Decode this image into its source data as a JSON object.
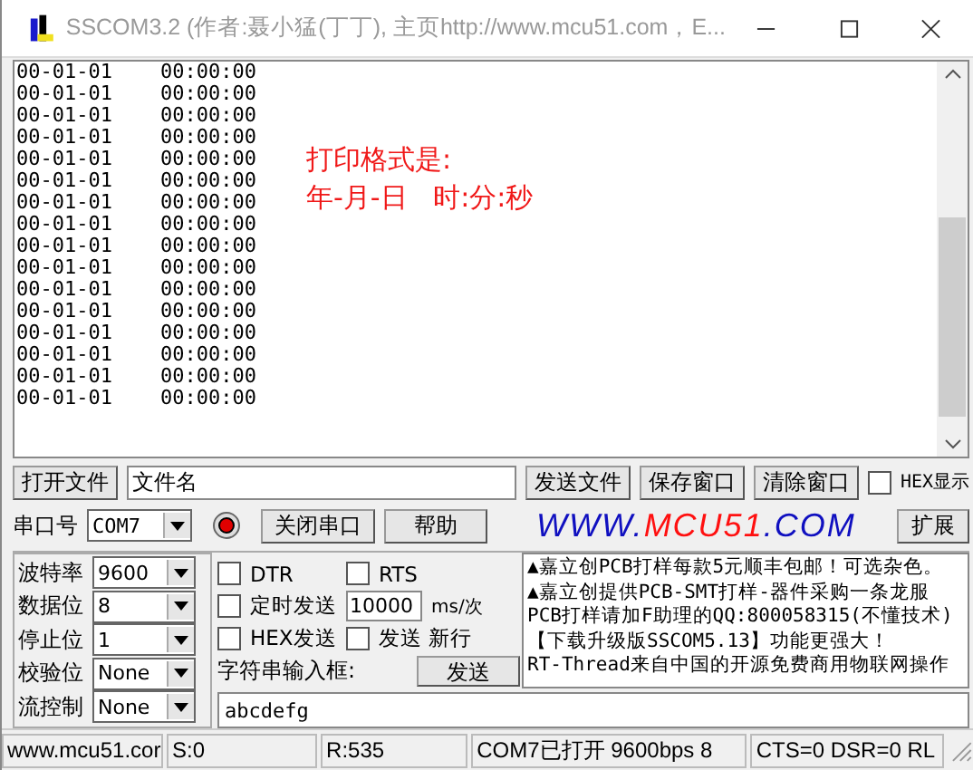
{
  "window": {
    "title": "SSCOM3.2 (作者:聂小猛(丁丁), 主页http://www.mcu51.com，E..."
  },
  "output": {
    "lines": [
      "00-01-01    00:00:00",
      "00-01-01    00:00:00",
      "00-01-01    00:00:00",
      "00-01-01    00:00:00",
      "00-01-01    00:00:00",
      "00-01-01    00:00:00",
      "00-01-01    00:00:00",
      "00-01-01    00:00:00",
      "00-01-01    00:00:00",
      "00-01-01    00:00:00",
      "00-01-01    00:00:00",
      "00-01-01    00:00:00",
      "00-01-01    00:00:00",
      "00-01-01    00:00:00",
      "00-01-01    00:00:00",
      "00-01-01    00:00:00"
    ],
    "note": [
      "打印格式是:",
      "年-月-日   时:分:秒"
    ]
  },
  "file_row": {
    "open_button": "打开文件",
    "file_field": "文件名",
    "send_file_button": "发送文件",
    "save_button": "保存窗口",
    "clear_button": "清除窗口",
    "hex_display": {
      "label": "HEX显示",
      "checked": false
    }
  },
  "port_row": {
    "label": "串口号",
    "port": "COM7",
    "port_open": true,
    "close_button": "关闭串口",
    "help_button": "帮助",
    "logo": [
      {
        "text": "WWW.",
        "color": "#1010c0"
      },
      {
        "text": "MCU51",
        "color": "#ff1010"
      },
      {
        "text": ".COM",
        "color": "#1010c0"
      }
    ],
    "expand_button": "扩展"
  },
  "settings": [
    {
      "label": "波特率",
      "value": "9600"
    },
    {
      "label": "数据位",
      "value": "8"
    },
    {
      "label": "停止位",
      "value": "1"
    },
    {
      "label": "校验位",
      "value": "None"
    },
    {
      "label": "流控制",
      "value": "None"
    }
  ],
  "options": {
    "dtr": {
      "label": "DTR",
      "checked": false
    },
    "rts": {
      "label": "RTS",
      "checked": false
    },
    "timed_send": {
      "label": "定时发送",
      "checked": false
    },
    "interval": "10000",
    "interval_unit": "ms/次",
    "hex_send": {
      "label": "HEX发送",
      "checked": false
    },
    "send_newline": {
      "label": "发送 新行",
      "checked": false
    },
    "input_label": "字符串输入框:",
    "send_button": "发送",
    "input_value": "abcdefg"
  },
  "notices": [
    "▲嘉立创PCB打样每款5元顺丰包邮！可选杂色。",
    "▲嘉立创提供PCB-SMT打样-器件采购一条龙服",
    "PCB打样请加F助理的QQ:800058315(不懂技术)",
    "【下载升级版SSCOM5.13】功能更强大！",
    "RT-Thread来自中国的开源免费商用物联网操作"
  ],
  "status_bar": [
    "www.mcu51.cor",
    "S:0",
    "R:535",
    "COM7已打开  9600bps  8",
    "CTS=0 DSR=0 RL"
  ]
}
